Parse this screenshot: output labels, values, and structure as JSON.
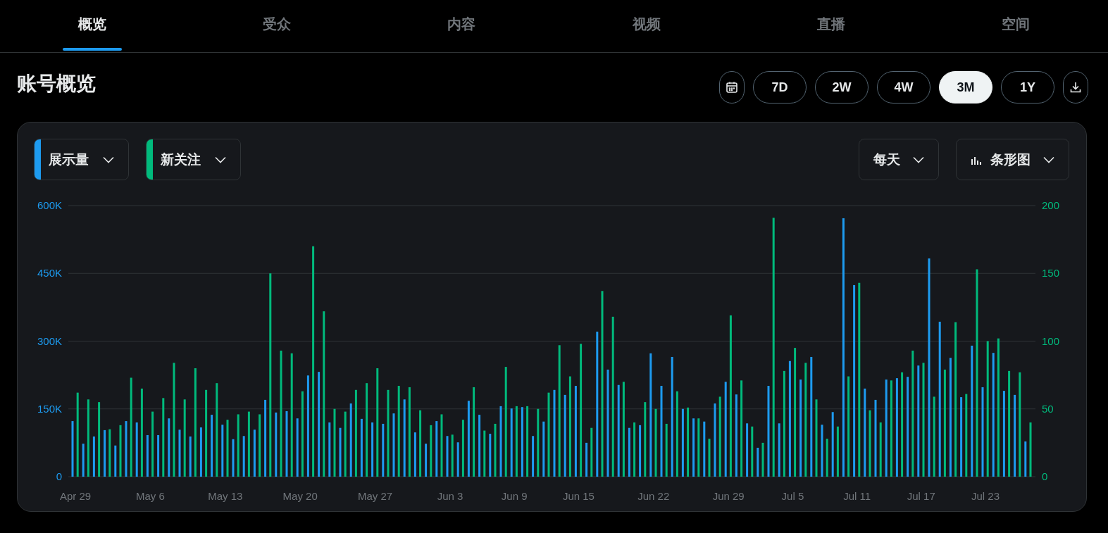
{
  "tabs": [
    {
      "label": "概览",
      "selected": true
    },
    {
      "label": "受众",
      "selected": false
    },
    {
      "label": "内容",
      "selected": false
    },
    {
      "label": "视频",
      "selected": false
    },
    {
      "label": "直播",
      "selected": false
    },
    {
      "label": "空间",
      "selected": false
    }
  ],
  "overview": {
    "title": "账号概览",
    "ranges": [
      {
        "label": "7D",
        "selected": false
      },
      {
        "label": "2W",
        "selected": false
      },
      {
        "label": "4W",
        "selected": false
      },
      {
        "label": "3M",
        "selected": true
      },
      {
        "label": "1Y",
        "selected": false
      }
    ],
    "interval": "每天",
    "chart_type": "条形图",
    "chart_data": {
      "type": "bar",
      "stacked": false,
      "grid": true,
      "categories": [
        "Apr 29",
        null,
        null,
        null,
        null,
        null,
        null,
        "May 6",
        null,
        null,
        null,
        null,
        null,
        null,
        "May 13",
        null,
        null,
        null,
        null,
        null,
        null,
        "May 20",
        null,
        null,
        null,
        null,
        null,
        null,
        "May 27",
        null,
        null,
        null,
        null,
        null,
        null,
        "Jun 3",
        null,
        null,
        null,
        null,
        null,
        "Jun 9",
        null,
        null,
        null,
        null,
        null,
        "Jun 15",
        null,
        null,
        null,
        null,
        null,
        null,
        "Jun 22",
        null,
        null,
        null,
        null,
        null,
        null,
        "Jun 29",
        null,
        null,
        null,
        null,
        null,
        "Jul 5",
        null,
        null,
        null,
        null,
        null,
        "Jul 11",
        null,
        null,
        null,
        null,
        null,
        "Jul 17",
        null,
        null,
        null,
        null,
        null,
        "Jul 23",
        null,
        null,
        null,
        null
      ],
      "series": [
        {
          "name": "展示量",
          "color": "#1d9bf0",
          "values": [
            123000,
            73000,
            89000,
            103000,
            69000,
            123000,
            120000,
            92000,
            92000,
            129000,
            104000,
            89000,
            109000,
            137000,
            115000,
            83000,
            90000,
            104000,
            170000,
            142000,
            145000,
            129000,
            224000,
            232000,
            120000,
            108000,
            162000,
            128000,
            120000,
            117000,
            140000,
            171000,
            98000,
            73000,
            123000,
            90000,
            76000,
            168000,
            137000,
            95000,
            156000,
            151000,
            154000,
            90000,
            122000,
            192000,
            181000,
            201000,
            75000,
            321000,
            237000,
            203000,
            108000,
            114000,
            273000,
            201000,
            265000,
            150000,
            129000,
            122000,
            162000,
            210000,
            182000,
            118000,
            64000,
            201000,
            118000,
            256000,
            215000,
            265000,
            115000,
            143000,
            572000,
            424000,
            195000,
            170000,
            215000,
            218000,
            221000,
            246000,
            483000,
            343000,
            263000,
            176000,
            290000,
            198000,
            274000,
            190000,
            181000,
            78000
          ]
        },
        {
          "name": "新关注",
          "color": "#00ba7c",
          "axis": "y2",
          "values": [
            62,
            57,
            55,
            35,
            38,
            73,
            65,
            48,
            58,
            84,
            57,
            80,
            64,
            69,
            42,
            46,
            48,
            46,
            150,
            93,
            91,
            63,
            170,
            122,
            50,
            48,
            64,
            69,
            80,
            64,
            67,
            66,
            49,
            38,
            46,
            31,
            42,
            66,
            34,
            39,
            81,
            52,
            52,
            50,
            62,
            97,
            74,
            98,
            36,
            137,
            118,
            70,
            40,
            55,
            50,
            39,
            63,
            51,
            43,
            28,
            59,
            119,
            71,
            37,
            25,
            191,
            78,
            95,
            84,
            57,
            28,
            37,
            74,
            143,
            49,
            40,
            71,
            77,
            93,
            84,
            59,
            79,
            114,
            61,
            153,
            100,
            102,
            78,
            77,
            40
          ]
        }
      ],
      "ylim": [
        0,
        600000
      ],
      "yticks": [
        {
          "value": 0,
          "label": "0"
        },
        {
          "value": 150000,
          "label": "150K"
        },
        {
          "value": 300000,
          "label": "300K"
        },
        {
          "value": 450000,
          "label": "450K"
        },
        {
          "value": 600000,
          "label": "600K"
        }
      ],
      "y2lim": [
        0,
        200
      ],
      "y2ticks": [
        0,
        50,
        100,
        150,
        200
      ]
    }
  }
}
